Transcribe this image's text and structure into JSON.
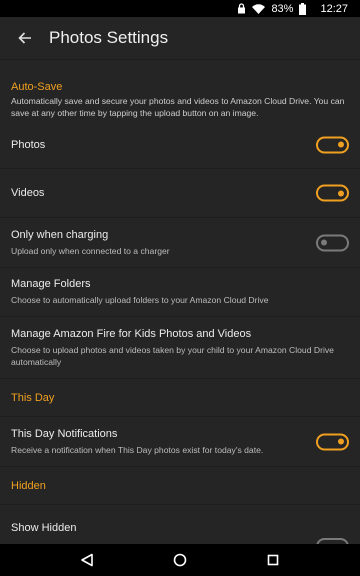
{
  "status_bar": {
    "battery": "83%",
    "time": "12:27"
  },
  "header": {
    "title": "Photos Settings"
  },
  "autosave": {
    "label": "Auto-Save",
    "description": "Automatically save and secure your photos and videos to Amazon Cloud Drive. You can save at any other time by tapping the upload button on an image.",
    "items": [
      {
        "label": "Photos",
        "description": "",
        "toggle": true
      },
      {
        "label": "Videos",
        "description": "",
        "toggle": true
      },
      {
        "label": "Only when charging",
        "description": "Upload only when connected to a charger",
        "toggle": false
      },
      {
        "label": "Manage Folders",
        "description": "Choose to automatically upload folders to your Amazon Cloud Drive"
      },
      {
        "label": "Manage Amazon Fire for Kids Photos and Videos",
        "description": "Choose to upload photos and videos taken by your child to your Amazon Cloud Drive automatically"
      }
    ]
  },
  "this_day": {
    "label": "This Day",
    "items": [
      {
        "label": "This Day Notifications",
        "description": "Receive a notification when This Day photos exist for today's date.",
        "toggle": true
      }
    ]
  },
  "hidden": {
    "label": "Hidden",
    "items": [
      {
        "label": "Show Hidden",
        "toggle": false
      }
    ]
  },
  "colors": {
    "accent": "#f0a020",
    "background": "#252525",
    "toggle_off": "#7a7a7a"
  }
}
